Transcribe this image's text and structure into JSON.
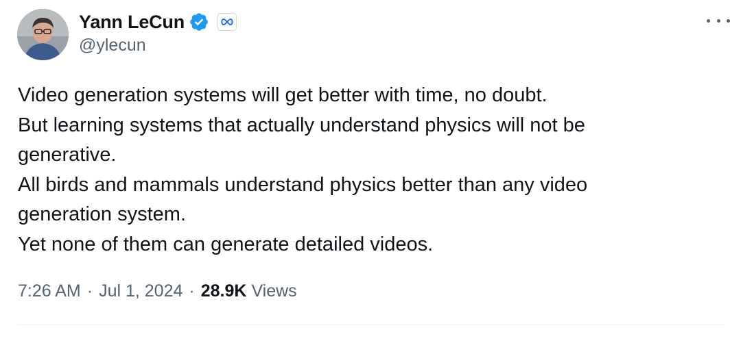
{
  "author": {
    "display_name": "Yann LeCun",
    "handle": "@ylecun",
    "verified_icon": "verified-badge-icon",
    "affiliate_icon": "meta-infinity-logo-icon"
  },
  "tweet": {
    "lines": [
      "Video generation systems will get better with time, no doubt.",
      "But learning systems that actually understand physics will not be",
      "generative.",
      "All birds and mammals understand physics better than any video",
      "generation system.",
      "Yet none of them can generate detailed videos."
    ]
  },
  "meta": {
    "time": "7:26 AM",
    "separator": "·",
    "date": "Jul 1, 2024",
    "views_count": "28.9K",
    "views_label": "Views"
  },
  "colors": {
    "text_primary": "#0f1419",
    "text_secondary": "#536471",
    "verified_blue": "#1d9bf0",
    "divider": "#eff3f4"
  }
}
